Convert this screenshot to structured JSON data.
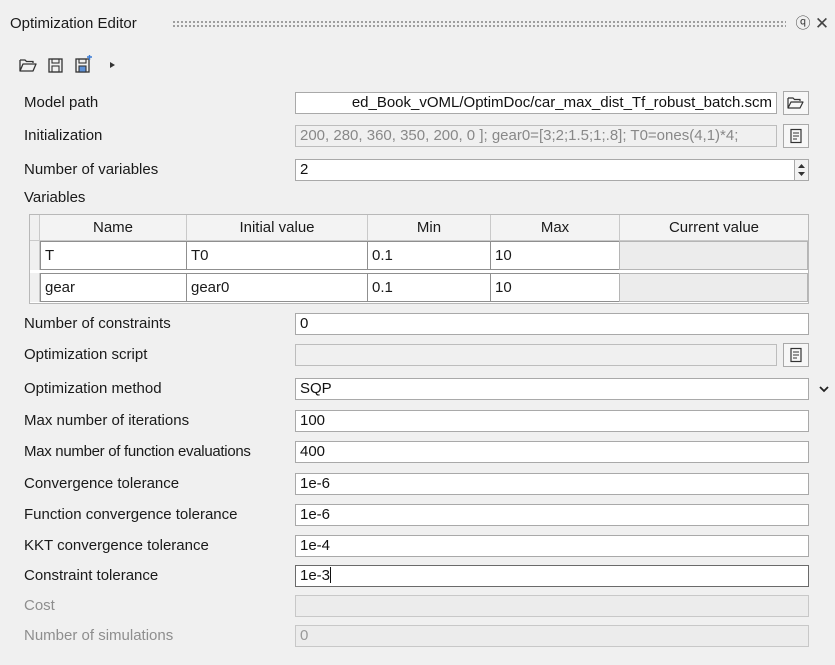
{
  "title_bar": {
    "title": "Optimization Editor"
  },
  "toolbar": {
    "icons": [
      "open-folder-icon",
      "save-icon",
      "save-as-icon",
      "run-icon"
    ]
  },
  "model_path": {
    "label": "Model path",
    "value": "ed_Book_vOML/OptimDoc/car_max_dist_Tf_robust_batch.scm"
  },
  "initialization": {
    "label": "Initialization",
    "value": "200, 280, 360, 350, 200, 0  ]; gear0=[3;2;1.5;1;.8]; T0=ones(4,1)*4;"
  },
  "number_of_variables": {
    "label": "Number of variables",
    "value": "2"
  },
  "variables": {
    "label": "Variables",
    "columns": [
      "Name",
      "Initial value",
      "Min",
      "Max",
      "Current value"
    ],
    "rows": [
      [
        "T",
        "T0",
        "0.1",
        "10",
        ""
      ],
      [
        "gear",
        "gear0",
        "0.1",
        "10",
        ""
      ]
    ]
  },
  "number_of_constraints": {
    "label": "Number of constraints",
    "value": "0"
  },
  "optimization_script": {
    "label": "Optimization script",
    "value": ""
  },
  "optimization_method": {
    "label": "Optimization method",
    "value": "SQP"
  },
  "max_iterations": {
    "label": "Max number of iterations",
    "value": "100"
  },
  "max_function_evaluations": {
    "label": "Max number of function evaluations",
    "value": "400"
  },
  "convergence_tolerance": {
    "label": "Convergence tolerance",
    "value": "1e-6"
  },
  "function_convergence_tolerance": {
    "label": "Function convergence tolerance",
    "value": "1e-6"
  },
  "kkt_convergence_tolerance": {
    "label": "KKT convergence tolerance",
    "value": "1e-4"
  },
  "constraint_tolerance": {
    "label": "Constraint tolerance",
    "value": "1e-3"
  },
  "cost": {
    "label": "Cost",
    "value": ""
  },
  "number_of_simulations": {
    "label": "Number of simulations",
    "value": "0"
  }
}
